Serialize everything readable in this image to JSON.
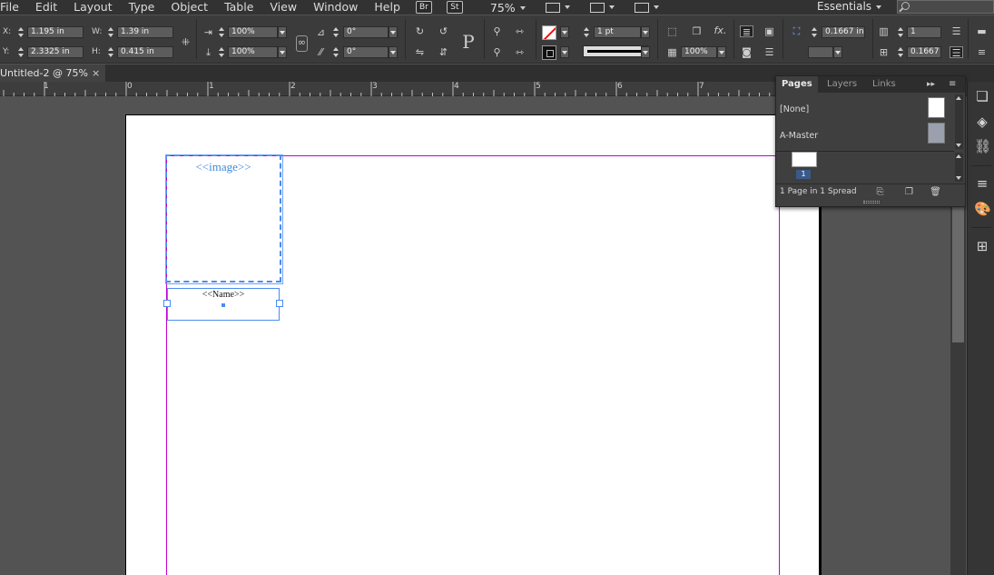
{
  "menubar": {
    "items": [
      "File",
      "Edit",
      "Layout",
      "Type",
      "Object",
      "Table",
      "View",
      "Window",
      "Help"
    ],
    "bridge_badge": "Br",
    "stock_badge": "St",
    "zoom": "75%",
    "workspace": "Essentials"
  },
  "control_panel": {
    "x_label": "X:",
    "x_value": "1.195 in",
    "y_label": "Y:",
    "y_value": "2.3325 in",
    "w_label": "W:",
    "w_value": "1.39 in",
    "h_label": "H:",
    "h_value": "0.415 in",
    "scale_x": "100%",
    "scale_y": "100%",
    "rotation": "0°",
    "shear": "0°",
    "stroke_weight": "1 pt",
    "opacity": "100%",
    "fitting_offset": "0.1667 in",
    "columns": "1",
    "gutter": "0.1667"
  },
  "tab": {
    "title": "Untitled-2 @ 75%",
    "close": "×"
  },
  "ruler": {
    "labels": [
      "1",
      "0",
      "1",
      "2",
      "3",
      "4",
      "5",
      "6",
      "7"
    ]
  },
  "canvas": {
    "image_placeholder": "<<image>>",
    "name_placeholder": "<<Name>>"
  },
  "pages_panel": {
    "tabs": [
      "Pages",
      "Layers",
      "Links"
    ],
    "masters": [
      "[None]",
      "A-Master"
    ],
    "page_number": "1",
    "status": "1 Page in 1 Spread"
  },
  "colors": {
    "accent_blue": "#4a8cf0",
    "margin_guide": "#c000d0",
    "placeholder_text": "#3f8ad6"
  }
}
